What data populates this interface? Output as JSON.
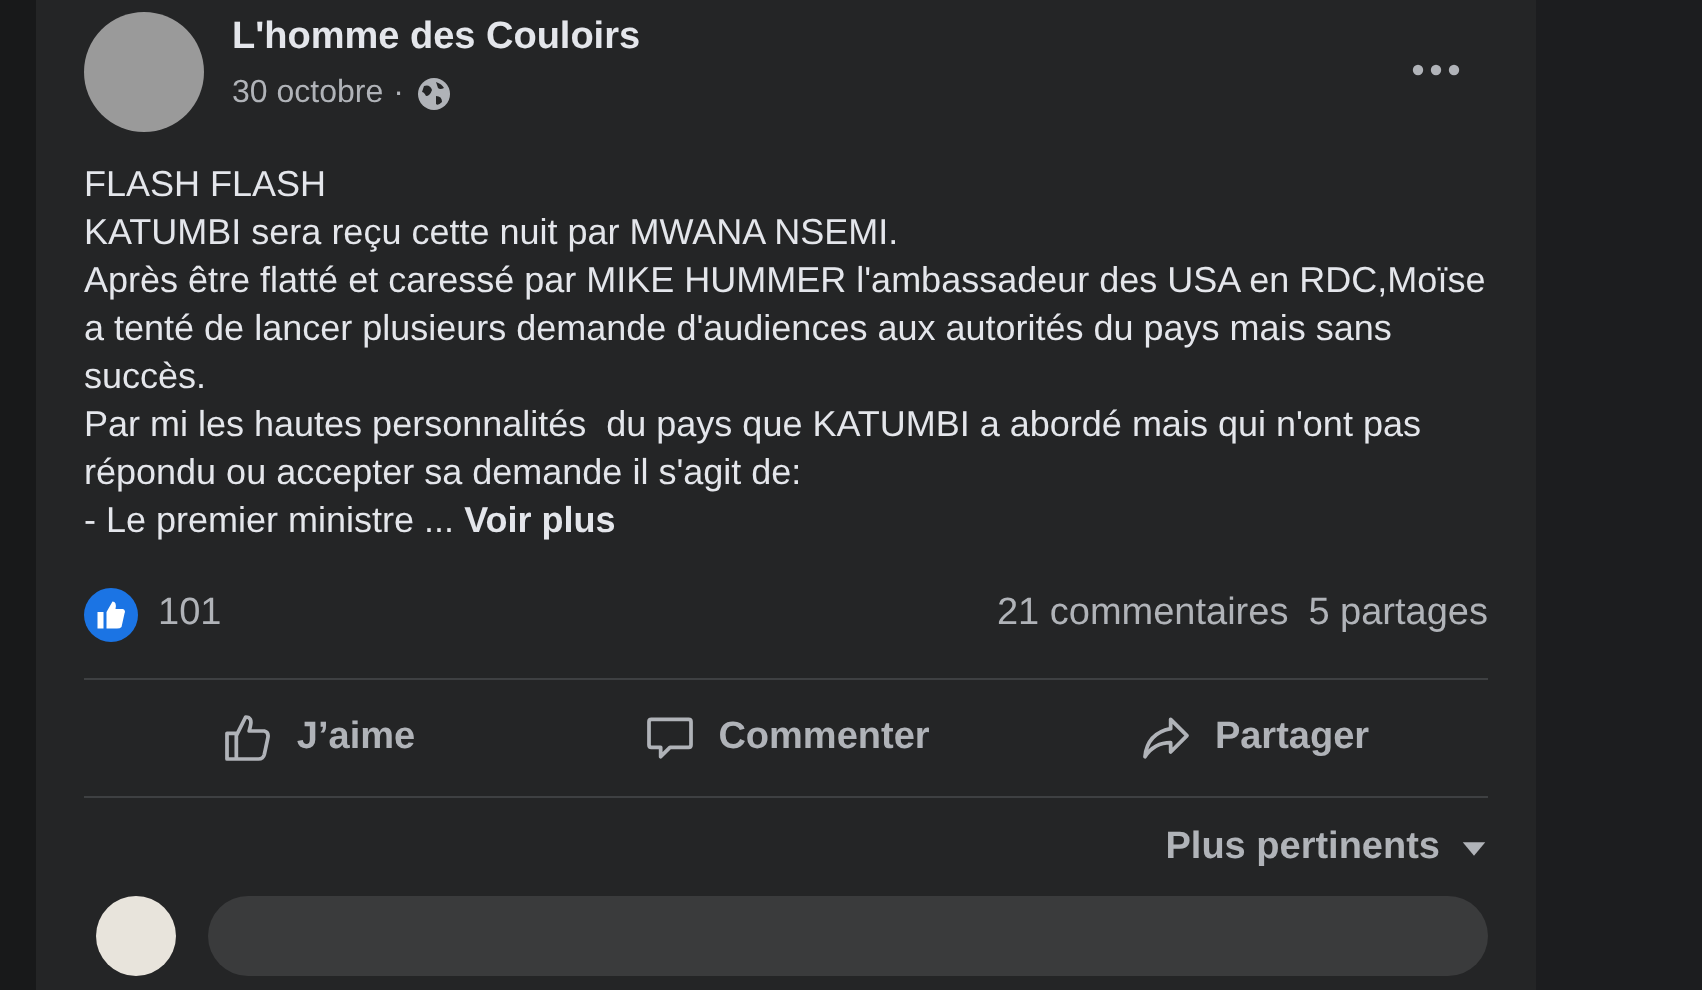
{
  "post": {
    "author": "L'homme des Couloirs",
    "date": "30 octobre",
    "separator": "·",
    "paragraphs": [
      "FLASH FLASH",
      "KATUMBI sera reçu cette nuit par MWANA NSEMI.",
      "Après être flatté et caressé par MIKE HUMMER l'ambassadeur des USA en RDC,Moïse a tenté de lancer plusieurs demande d'audiences aux autorités du pays mais sans succès.",
      "Par mi les hautes personnalités  du pays que KATUMBI a abordé mais qui n'ont pas répondu ou accepter sa demande il s'agit de:",
      "- Le premier ministre ..."
    ],
    "see_more": "Voir plus",
    "reactions_count": "101",
    "comments_count": "21 commentaires",
    "shares_count": "5 partages",
    "actions": [
      {
        "kind": "like",
        "label": "J’aime"
      },
      {
        "kind": "comment",
        "label": "Commenter"
      },
      {
        "kind": "share",
        "label": "Partager"
      }
    ],
    "sort": "Plus pertinents"
  }
}
